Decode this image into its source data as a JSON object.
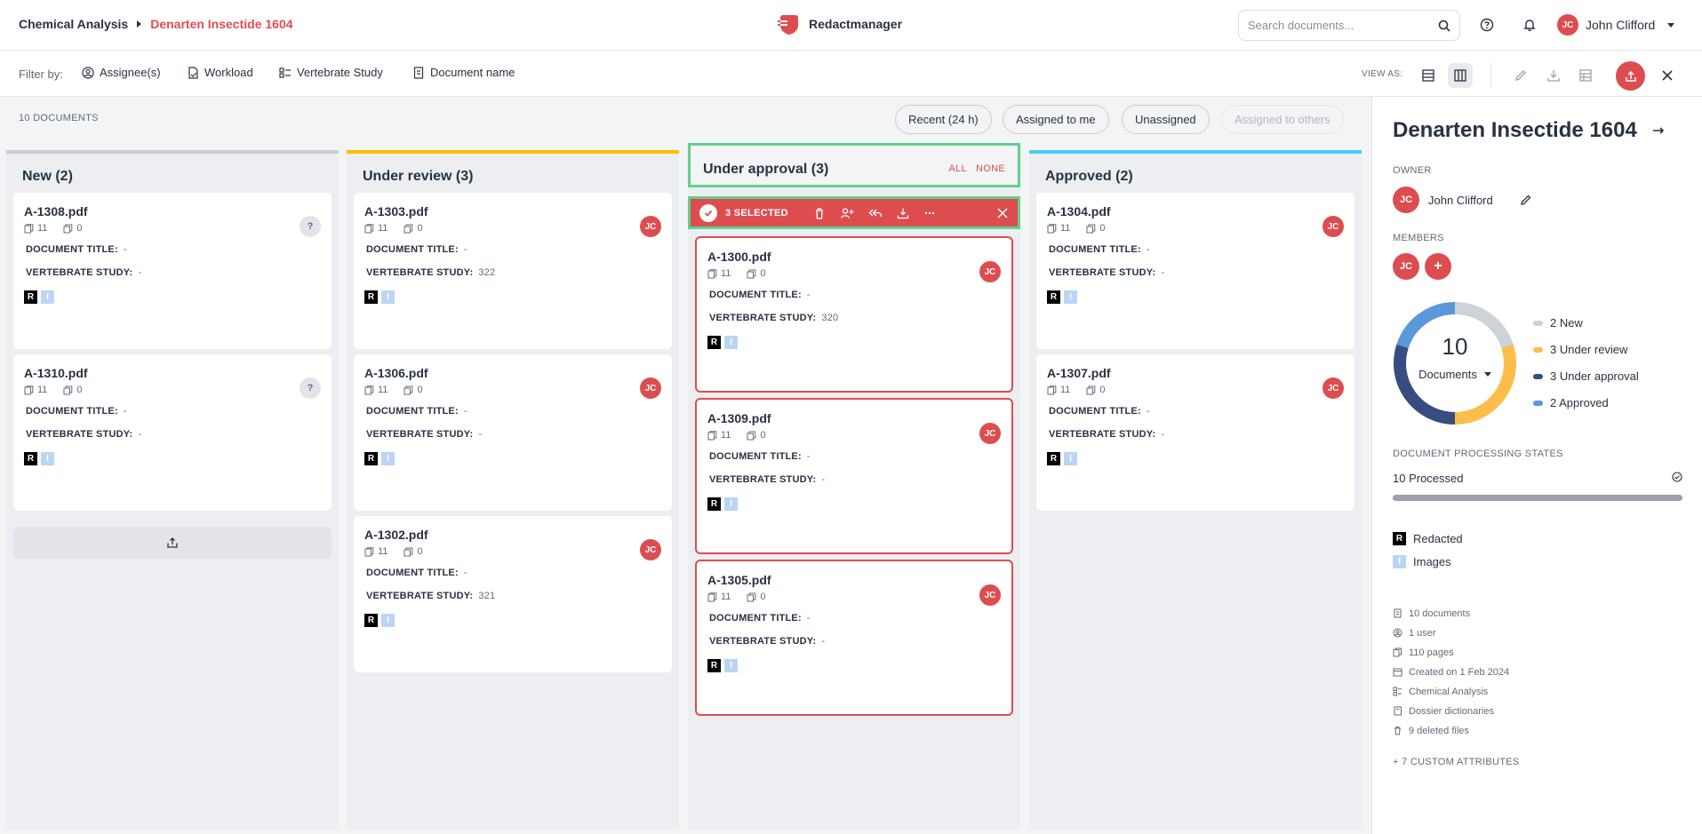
{
  "breadcrumb": {
    "parent": "Chemical Analysis",
    "current": "Denarten Insectide 1604"
  },
  "brand": {
    "name": "Redactmanager",
    "color": "#dd4d50"
  },
  "search": {
    "placeholder": "Search documents..."
  },
  "user": {
    "initials": "JC",
    "name": "John Clifford"
  },
  "filterbar": {
    "label": "Filter by:",
    "filters": [
      "Assignee(s)",
      "Workload",
      "Vertebrate Study",
      "Document name"
    ],
    "view_as_label": "VIEW AS:"
  },
  "toolbar": {
    "doc_count": "10 DOCUMENTS",
    "quick_filters": [
      "Recent (24 h)",
      "Assigned to me",
      "Unassigned",
      "Assigned to others"
    ]
  },
  "columns": {
    "new": {
      "title": "New (2)",
      "color": "#c9ccd3",
      "cards": [
        {
          "name": "A-1308.pdf",
          "pages": "11",
          "files": "0",
          "title_label": "DOCUMENT TITLE:",
          "title_value": "-",
          "study_label": "VERTEBRATE STUDY:",
          "study_value": "-",
          "assignee": "?"
        },
        {
          "name": "A-1310.pdf",
          "pages": "11",
          "files": "0",
          "title_label": "DOCUMENT TITLE:",
          "title_value": "-",
          "study_label": "VERTEBRATE STUDY:",
          "study_value": "-",
          "assignee": "?"
        }
      ]
    },
    "under_review": {
      "title": "Under review (3)",
      "color": "#fdbd00",
      "cards": [
        {
          "name": "A-1303.pdf",
          "pages": "11",
          "files": "0",
          "title_label": "DOCUMENT TITLE:",
          "title_value": "-",
          "study_label": "VERTEBRATE STUDY:",
          "study_value": "322",
          "assignee": "JC"
        },
        {
          "name": "A-1306.pdf",
          "pages": "11",
          "files": "0",
          "title_label": "DOCUMENT TITLE:",
          "title_value": "-",
          "study_label": "VERTEBRATE STUDY:",
          "study_value": "-",
          "assignee": "JC"
        },
        {
          "name": "A-1302.pdf",
          "pages": "11",
          "files": "0",
          "title_label": "DOCUMENT TITLE:",
          "title_value": "-",
          "study_label": "VERTEBRATE STUDY:",
          "study_value": "321",
          "assignee": "JC"
        }
      ]
    },
    "under_approval": {
      "title": "Under approval (3)",
      "color": "#374c81",
      "all_label": "ALL",
      "none_label": "NONE",
      "selected_label": "3 SELECTED",
      "cards": [
        {
          "name": "A-1300.pdf",
          "pages": "11",
          "files": "0",
          "title_label": "DOCUMENT TITLE:",
          "title_value": "-",
          "study_label": "VERTEBRATE STUDY:",
          "study_value": "320",
          "assignee": "JC"
        },
        {
          "name": "A-1309.pdf",
          "pages": "11",
          "files": "0",
          "title_label": "DOCUMENT TITLE:",
          "title_value": "-",
          "study_label": "VERTEBRATE STUDY:",
          "study_value": "-",
          "assignee": "JC"
        },
        {
          "name": "A-1305.pdf",
          "pages": "11",
          "files": "0",
          "title_label": "DOCUMENT TITLE:",
          "title_value": "-",
          "study_label": "VERTEBRATE STUDY:",
          "study_value": "-",
          "assignee": "JC"
        }
      ]
    },
    "approved": {
      "title": "Approved (2)",
      "color": "#48c9f7",
      "cards": [
        {
          "name": "A-1304.pdf",
          "pages": "11",
          "files": "0",
          "title_label": "DOCUMENT TITLE:",
          "title_value": "-",
          "study_label": "VERTEBRATE STUDY:",
          "study_value": "-",
          "assignee": "JC"
        },
        {
          "name": "A-1307.pdf",
          "pages": "11",
          "files": "0",
          "title_label": "DOCUMENT TITLE:",
          "title_value": "-",
          "study_label": "VERTEBRATE STUDY:",
          "study_value": "-",
          "assignee": "JC"
        }
      ]
    }
  },
  "tags": {
    "redacted": "R",
    "images": "I"
  },
  "panel": {
    "title": "Denarten Insectide 1604",
    "owner_label": "OWNER",
    "owner_name": "John Clifford",
    "owner_initials": "JC",
    "members_label": "MEMBERS",
    "members_add": "+",
    "donut_total": "10",
    "donut_label": "Documents",
    "status_legend": [
      {
        "label": "2 New",
        "count": 2,
        "color": "#cfd2d8"
      },
      {
        "label": "3 Under review",
        "count": 3,
        "color": "#fdbd4a"
      },
      {
        "label": "3 Under approval",
        "count": 3,
        "color": "#374c81"
      },
      {
        "label": "2 Approved",
        "count": 2,
        "color": "#5b97db"
      }
    ],
    "processing_label": "DOCUMENT PROCESSING STATES",
    "processed_text": "10 Processed",
    "processed_fraction": 1.0,
    "legend_redacted": "Redacted",
    "legend_images": "Images",
    "meta": [
      {
        "icon": "document-icon",
        "text": "10 documents"
      },
      {
        "icon": "user-icon",
        "text": "1 user"
      },
      {
        "icon": "pages-icon",
        "text": "110 pages"
      },
      {
        "icon": "calendar-icon",
        "text": "Created on 1 Feb 2024"
      },
      {
        "icon": "template-icon",
        "text": "Chemical Analysis"
      },
      {
        "icon": "dictionary-icon",
        "text": "Dossier dictionaries"
      },
      {
        "icon": "trash-icon",
        "text": "9 deleted files"
      }
    ],
    "custom_attributes": "+ 7 CUSTOM ATTRIBUTES"
  }
}
